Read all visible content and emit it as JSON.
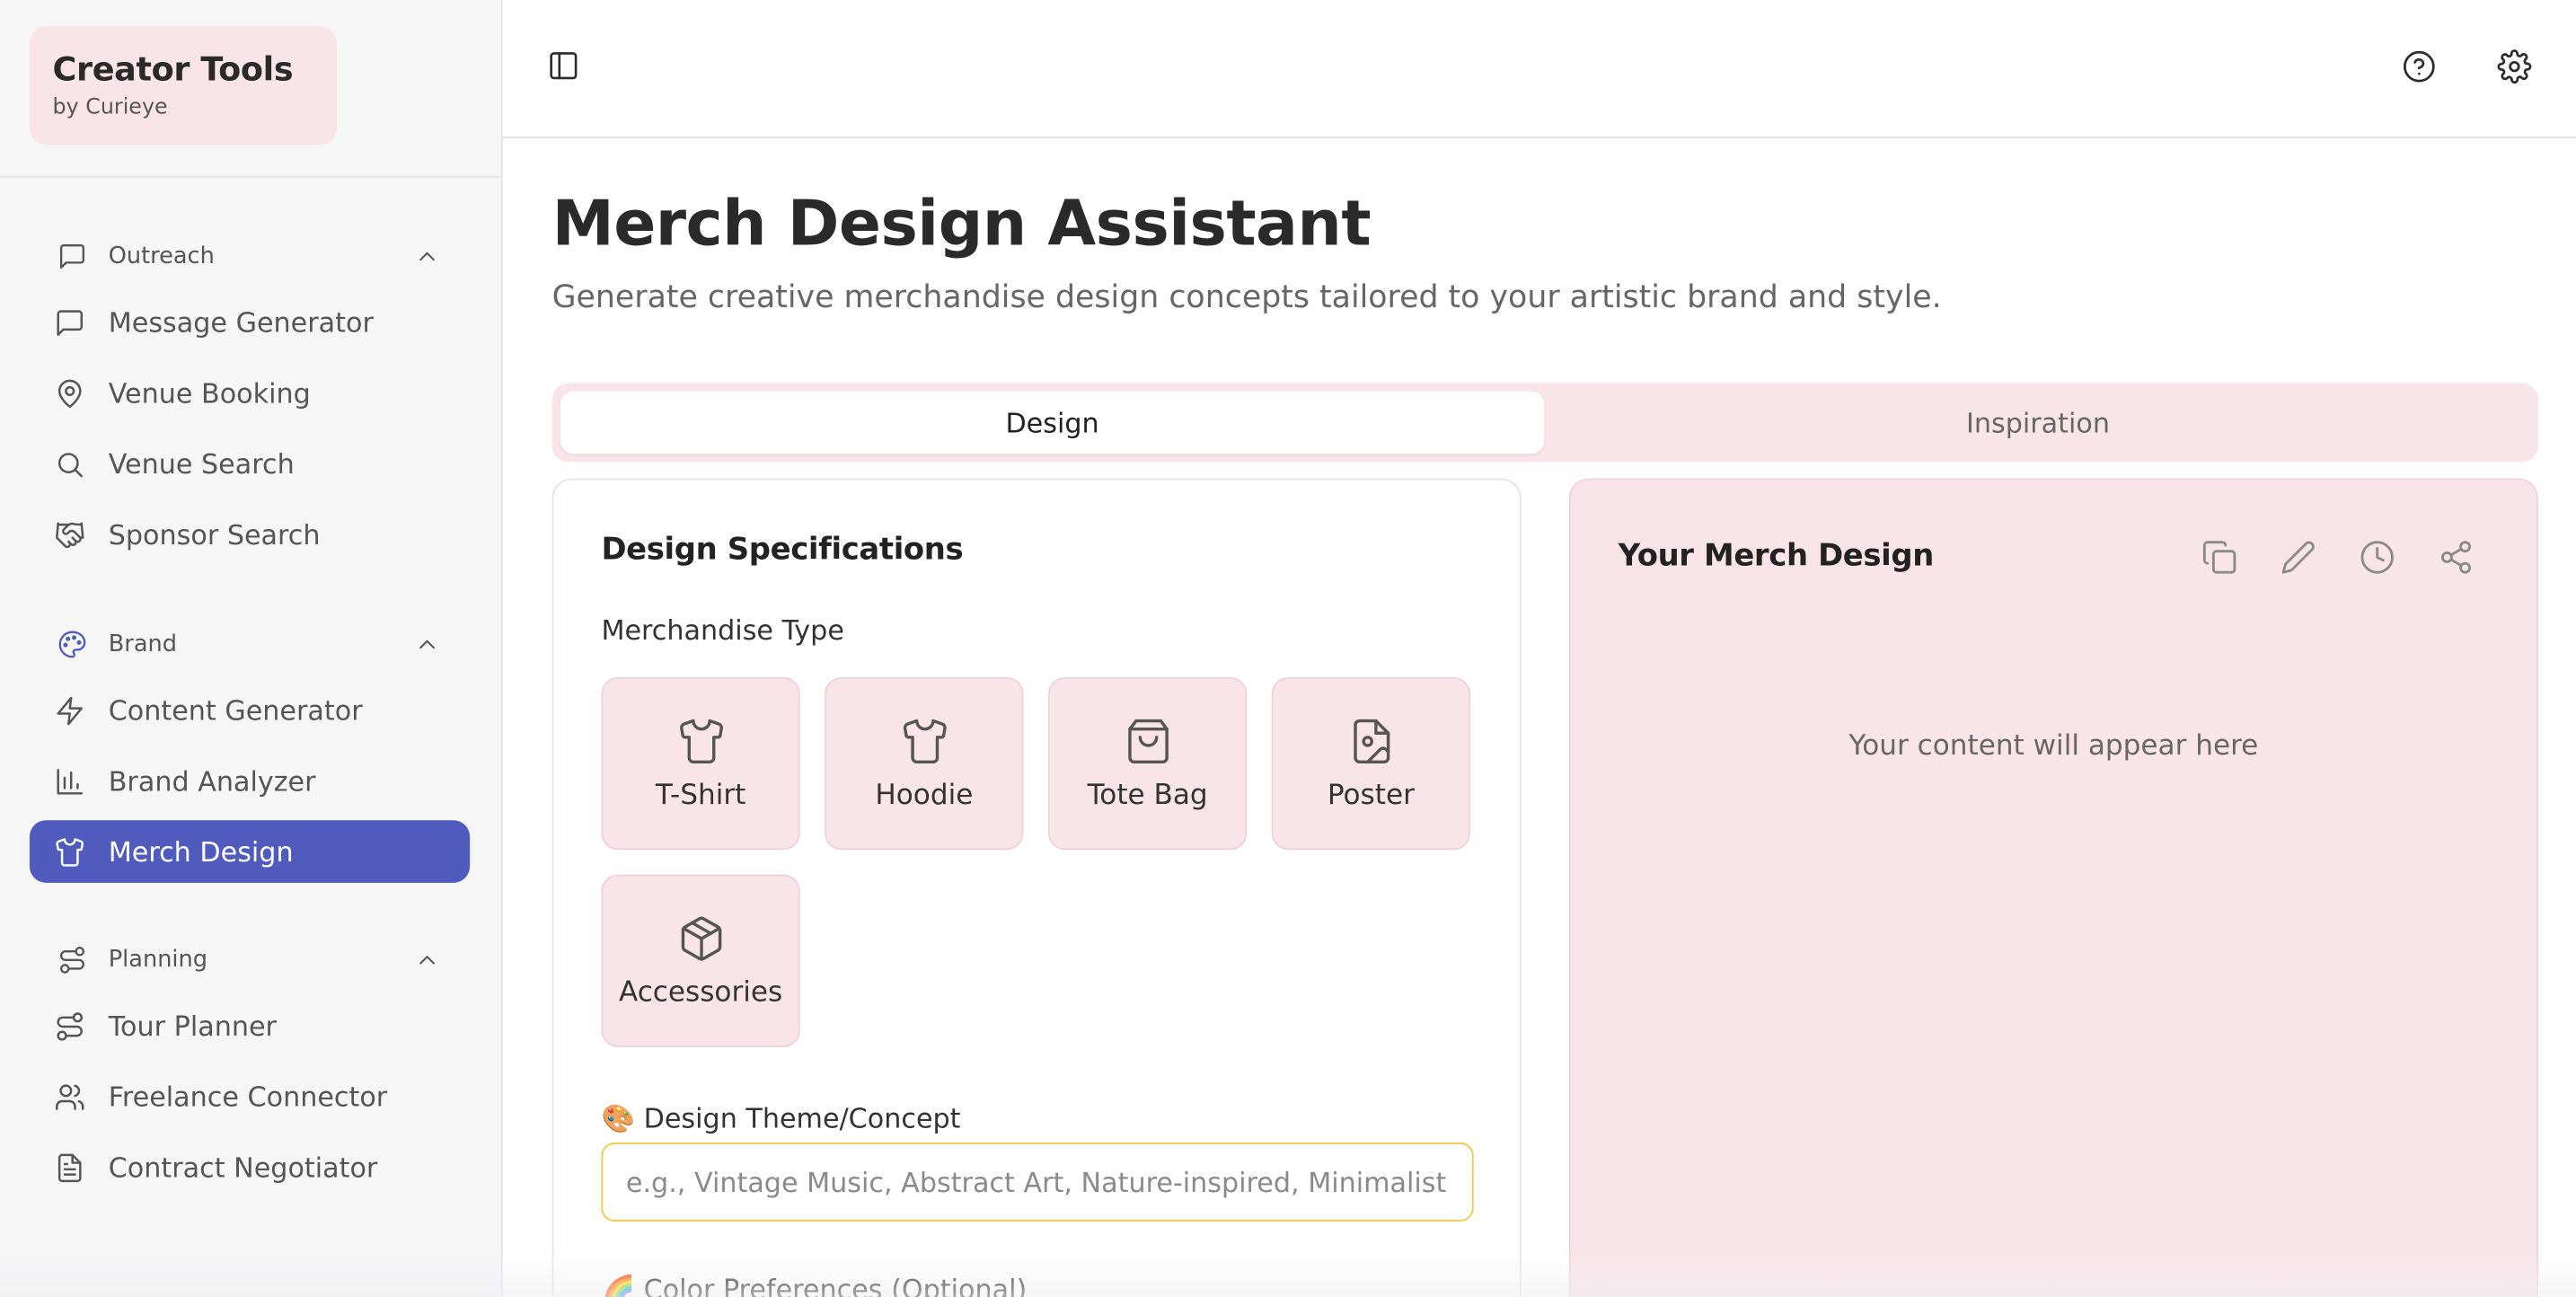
{
  "brand": {
    "title": "Creator Tools",
    "subtitle": "by Curieye"
  },
  "sidebar": {
    "sections": [
      {
        "label": "Outreach",
        "icon": "message-square-icon",
        "items": [
          {
            "label": "Message Generator",
            "icon": "message-square-icon"
          },
          {
            "label": "Venue Booking",
            "icon": "map-pin-icon"
          },
          {
            "label": "Venue Search",
            "icon": "search-icon"
          },
          {
            "label": "Sponsor Search",
            "icon": "handshake-icon"
          }
        ]
      },
      {
        "label": "Brand",
        "icon": "palette-icon",
        "items": [
          {
            "label": "Content Generator",
            "icon": "zap-icon"
          },
          {
            "label": "Brand Analyzer",
            "icon": "bar-chart-icon"
          },
          {
            "label": "Merch Design",
            "icon": "shirt-icon",
            "active": true
          }
        ]
      },
      {
        "label": "Planning",
        "icon": "route-icon",
        "items": [
          {
            "label": "Tour Planner",
            "icon": "route-icon"
          },
          {
            "label": "Freelance Connector",
            "icon": "users-icon"
          },
          {
            "label": "Contract Negotiator",
            "icon": "file-text-icon"
          }
        ]
      }
    ]
  },
  "main": {
    "title": "Merch Design Assistant",
    "subtitle": "Generate creative merchandise design concepts tailored to your artistic brand and style.",
    "tabs": [
      {
        "label": "Design",
        "active": true
      },
      {
        "label": "Inspiration"
      }
    ],
    "spec": {
      "title": "Design Specifications",
      "merch_type_label": "Merchandise Type",
      "merch_types": [
        {
          "label": "T-Shirt",
          "icon": "shirt-icon"
        },
        {
          "label": "Hoodie",
          "icon": "shirt-icon"
        },
        {
          "label": "Tote Bag",
          "icon": "shopping-bag-icon"
        },
        {
          "label": "Poster",
          "icon": "file-image-icon"
        },
        {
          "label": "Accessories",
          "icon": "package-icon"
        }
      ],
      "theme_label": "🎨 Design Theme/Concept",
      "theme_placeholder": "e.g., Vintage Music, Abstract Art, Nature-inspired, Minimalist...",
      "color_label": "🌈 Color Preferences (Optional)"
    },
    "output": {
      "title": "Your Merch Design",
      "placeholder": "Your content will appear here",
      "actions": [
        "copy-icon",
        "edit-icon",
        "history-icon",
        "share-icon"
      ]
    }
  },
  "colors": {
    "accent": "#4f5bbd",
    "pink_surface": "#f9e4ea",
    "input_focus": "#f0c94a"
  }
}
